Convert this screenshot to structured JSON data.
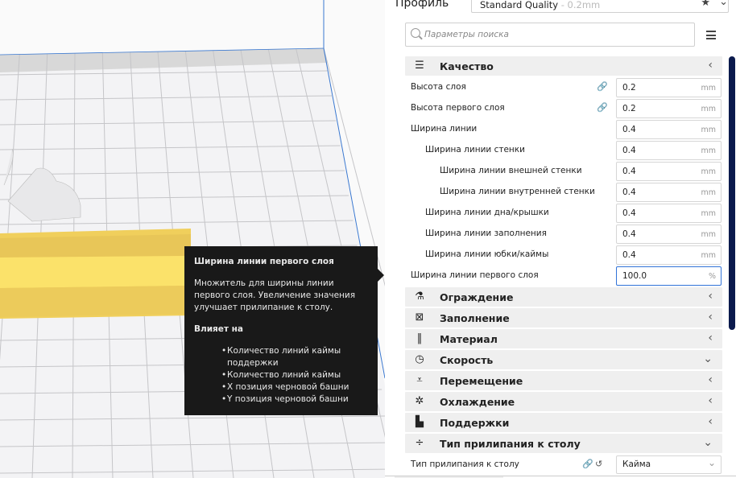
{
  "profile": {
    "label": "Профиль",
    "value": "Standard Quality",
    "value_suffix": " - 0.2mm"
  },
  "search": {
    "placeholder": "Параметры поиска"
  },
  "sections_top": {
    "icon": "quality-icon",
    "label": "Качество",
    "state": "collapsed-arrow"
  },
  "settings": [
    {
      "label": "Высота слоя",
      "value": "0.2",
      "unit": "mm",
      "indent": 0,
      "linked": true
    },
    {
      "label": "Высота первого слоя",
      "value": "0.2",
      "unit": "mm",
      "indent": 0,
      "linked": true
    },
    {
      "label": "Ширина линии",
      "value": "0.4",
      "unit": "mm",
      "indent": 0
    },
    {
      "label": "Ширина линии стенки",
      "value": "0.4",
      "unit": "mm",
      "indent": 1
    },
    {
      "label": "Ширина линии внешней стенки",
      "value": "0.4",
      "unit": "mm",
      "indent": 2
    },
    {
      "label": "Ширина линии внутренней стенки",
      "value": "0.4",
      "unit": "mm",
      "indent": 2
    },
    {
      "label": "Ширина линии дна/крышки",
      "value": "0.4",
      "unit": "mm",
      "indent": 1
    },
    {
      "label": "Ширина линии заполнения",
      "value": "0.4",
      "unit": "mm",
      "indent": 1
    },
    {
      "label": "Ширина линии юбки/каймы",
      "value": "0.4",
      "unit": "mm",
      "indent": 1
    },
    {
      "label": "Ширина линии первого слоя",
      "value": "100.0",
      "unit": "%",
      "indent": 0,
      "active": true
    }
  ],
  "sections": [
    {
      "label": "Ограждение",
      "icon": "shell-icon",
      "expanded": false
    },
    {
      "label": "Заполнение",
      "icon": "infill-icon",
      "expanded": false
    },
    {
      "label": "Материал",
      "icon": "material-icon",
      "expanded": false
    },
    {
      "label": "Скорость",
      "icon": "speed-icon",
      "expanded": true
    },
    {
      "label": "Перемещение",
      "icon": "travel-icon",
      "expanded": false
    },
    {
      "label": "Охлаждение",
      "icon": "cooling-icon",
      "expanded": false
    },
    {
      "label": "Поддержки",
      "icon": "support-icon",
      "expanded": false
    },
    {
      "label": "Тип прилипания к столу",
      "icon": "adhesion-icon",
      "expanded": true
    }
  ],
  "adhesion_row": {
    "label": "Тип прилипания к столу",
    "value": "Кайма"
  },
  "tooltip": {
    "title": "Ширина линии первого слоя",
    "body": "Множитель для ширины линии первого слоя. Увеличение значения улучшает прилипание к столу.",
    "affects_label": "Влияет на",
    "affects": [
      "Количество линий каймы поддержки",
      "Количество линий каймы",
      "X позиция черновой башни",
      "Y позиция черновой башни"
    ]
  },
  "colors": {
    "accent": "#3173d8",
    "scrollbar": "#0b1a4d",
    "model": "#f8d860",
    "tooltip_bg": "#191919"
  }
}
